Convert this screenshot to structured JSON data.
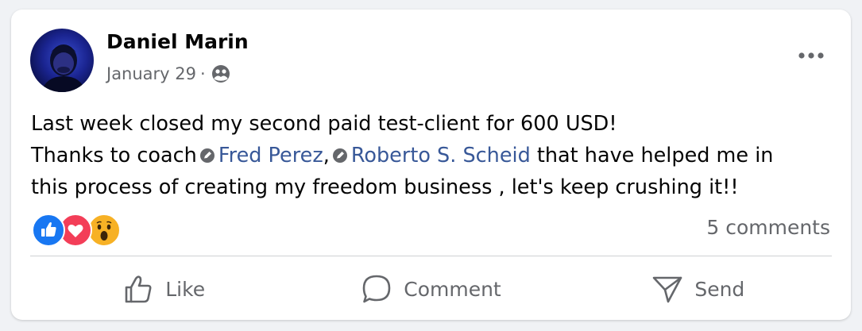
{
  "post": {
    "author": "Daniel Marin",
    "date": "January 29",
    "separator": "·",
    "audience_icon": "friends-icon",
    "text_line1": "Last week closed my second paid test-client for 600 USD!",
    "text_line2_prefix": "Thanks to coach",
    "mention1": "Fred Perez",
    "mention_separator": ",",
    "mention2": "Roberto S. Scheid",
    "text_line2_suffix": "that have helped me in",
    "text_line3": "this process of creating my freedom business , let's keep crushing it!!"
  },
  "reactions": {
    "icons": [
      "like-reaction-icon",
      "love-reaction-icon",
      "wow-reaction-icon"
    ],
    "colors": {
      "like": "#1877f2",
      "love": "#f33e58",
      "wow": "#f7b125"
    }
  },
  "stats": {
    "comments": "5 comments"
  },
  "actions": {
    "like": "Like",
    "comment": "Comment",
    "send": "Send"
  },
  "theme": {
    "text": "#050505",
    "secondary": "#65676b",
    "mention": "#385898",
    "divider": "#ced0d4"
  }
}
